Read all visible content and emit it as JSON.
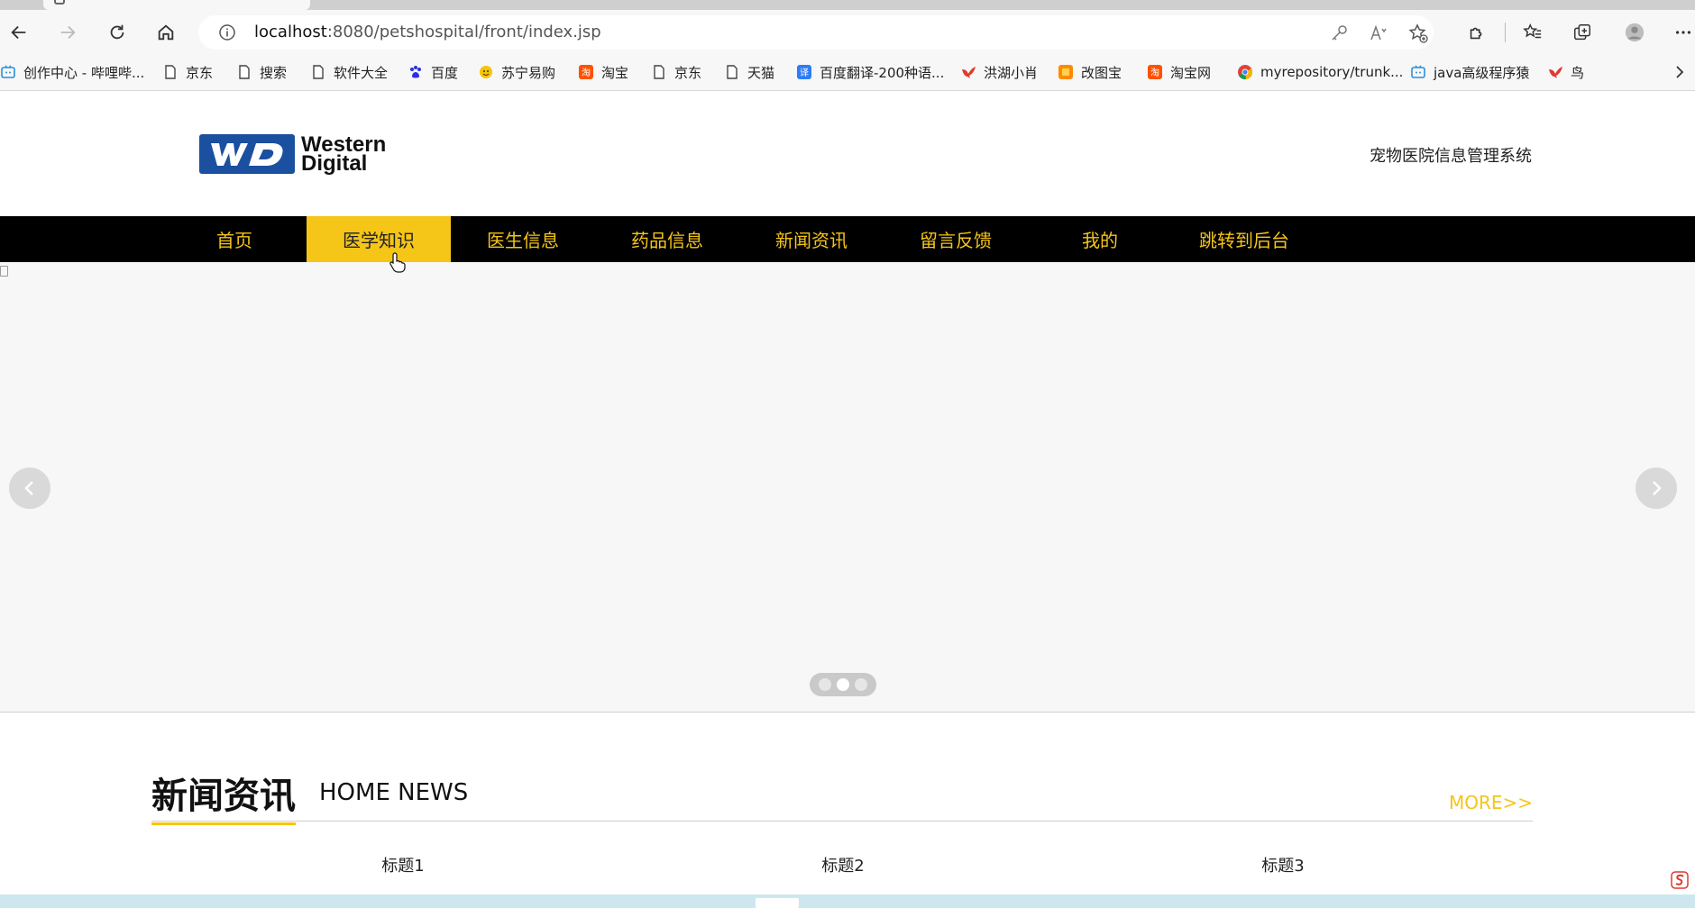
{
  "browser": {
    "url_host": "localhost",
    "url_rest": ":8080/petshospital/front/index.jsp",
    "bookmarks": [
      {
        "label": "创作中心 - 哔哩哔...",
        "icon": "bilibili-icon"
      },
      {
        "label": "京东",
        "icon": "page-icon"
      },
      {
        "label": "搜索",
        "icon": "page-icon"
      },
      {
        "label": "软件大全",
        "icon": "page-icon"
      },
      {
        "label": "百度",
        "icon": "baidu-paw-icon"
      },
      {
        "label": "苏宁易购",
        "icon": "suning-icon"
      },
      {
        "label": "淘宝",
        "icon": "taobao-icon"
      },
      {
        "label": "京东",
        "icon": "page-icon"
      },
      {
        "label": "天猫",
        "icon": "page-icon"
      },
      {
        "label": "百度翻译-200种语...",
        "icon": "translate-icon"
      },
      {
        "label": "洪湖小肖",
        "icon": "bird-icon"
      },
      {
        "label": "改图宝",
        "icon": "gaitubao-icon"
      },
      {
        "label": "淘宝网",
        "icon": "taobao-icon"
      },
      {
        "label": "myrepository/trunk...",
        "icon": "chrome-icon"
      },
      {
        "label": "java高级程序猿",
        "icon": "bilibili-icon"
      },
      {
        "label": "鸟",
        "icon": "bird-icon"
      }
    ]
  },
  "header": {
    "system_title": "宠物医院信息管理系统",
    "logo_text_1": "Western",
    "logo_text_2": "Digital"
  },
  "nav": {
    "items": [
      {
        "label": "首页"
      },
      {
        "label": "医学知识"
      },
      {
        "label": "医生信息"
      },
      {
        "label": "药品信息"
      },
      {
        "label": "新闻资讯"
      },
      {
        "label": "留言反馈"
      },
      {
        "label": "我的"
      },
      {
        "label": "跳转到后台"
      }
    ],
    "active_index": 1
  },
  "banner": {
    "slide_count": 3,
    "active_slide": 2
  },
  "news": {
    "title": "新闻资讯",
    "subtitle": "HOME NEWS",
    "more": "MORE>>",
    "items": [
      "标题1",
      "标题2",
      "标题3"
    ]
  },
  "colors": {
    "accent": "#f5c518",
    "nav_bg": "#000000",
    "banner_bg": "#f7f7f7"
  }
}
